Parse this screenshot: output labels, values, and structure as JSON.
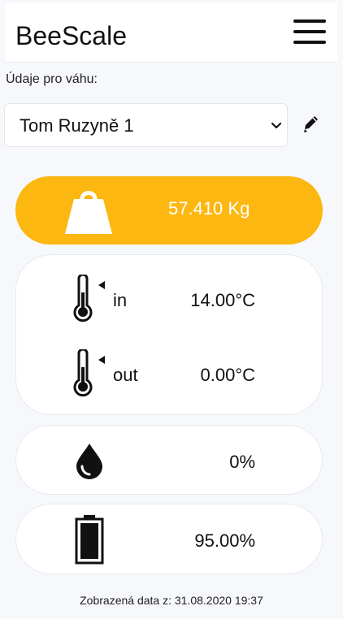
{
  "app": {
    "title": "BeeScale"
  },
  "scale": {
    "label": "Údaje pro váhu:",
    "selected": "Tom Ruzyně 1"
  },
  "weight": {
    "value": "57.410",
    "unit": "Kg"
  },
  "temperature": {
    "in_label": "in",
    "in_value": "14.00",
    "out_label": "out",
    "out_value": "0.00",
    "unit": "°C"
  },
  "humidity": {
    "value": "0",
    "unit": "%"
  },
  "battery": {
    "value": "95.00",
    "unit": "%"
  },
  "footer": {
    "text": "Zobrazená data z: 31.08.2020 19:37"
  },
  "colors": {
    "accent": "#fcb711",
    "background": "#f6f8fb"
  },
  "icons": [
    "menu-icon",
    "chevron-down-icon",
    "pencil-icon",
    "weight-icon",
    "thermometer-icon",
    "drop-icon",
    "battery-icon"
  ]
}
